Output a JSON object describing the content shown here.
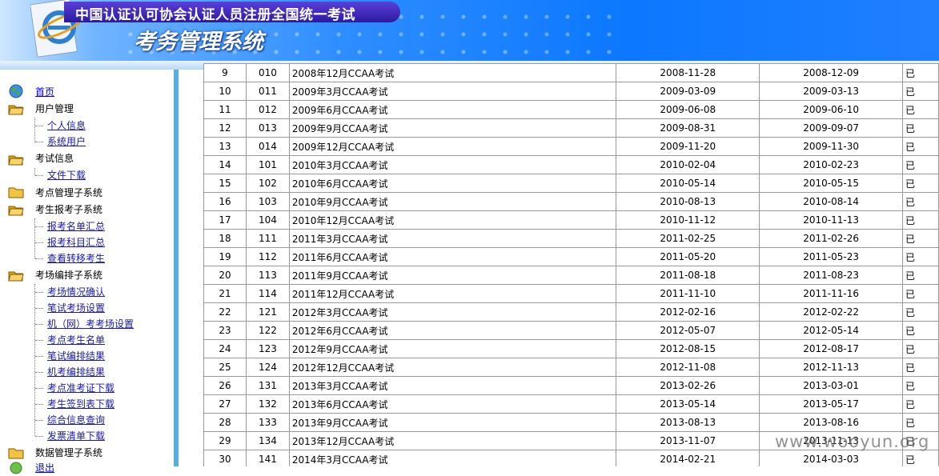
{
  "header": {
    "org_title": "中国认证认可协会认证人员注册全国统一考试",
    "system_title": "考务管理系统"
  },
  "menu": {
    "home": "首页",
    "user_mgmt": "用户管理",
    "personal_info": "个人信息",
    "system_user": "系统用户",
    "exam_info": "考试信息",
    "file_download": "文件下载",
    "site_subsystem": "考点管理子系统",
    "signup_subsystem": "考生报考子系统",
    "signup_list": "报考名单汇总",
    "signup_subjects": "报考科目汇总",
    "view_transfer": "查看转移考生",
    "room_subsystem": "考场编排子系统",
    "room_confirm": "考场情况确认",
    "written_room_setup": "笔试考场设置",
    "machine_room_setup": "机（网）考考场设置",
    "site_candidates": "考点考生名单",
    "written_result": "笔试编排结果",
    "machine_result": "机考编排结果",
    "admission_download": "考点准考证下载",
    "signin_download": "考生签到表下载",
    "info_query": "综合信息查询",
    "invoice_download": "发票清单下载",
    "data_subsystem": "数据管理子系统",
    "exit": "退出"
  },
  "table": {
    "rows": [
      {
        "no": "9",
        "code": "010",
        "name": "2008年12月CCAA考试",
        "start": "2008-11-28",
        "end": "2008-12-09",
        "status": "已"
      },
      {
        "no": "10",
        "code": "011",
        "name": "2009年3月CCAA考试",
        "start": "2009-03-09",
        "end": "2009-03-13",
        "status": "已"
      },
      {
        "no": "11",
        "code": "012",
        "name": "2009年6月CCAA考试",
        "start": "2009-06-08",
        "end": "2009-06-10",
        "status": "已"
      },
      {
        "no": "12",
        "code": "013",
        "name": "2009年9月CCAA考试",
        "start": "2009-08-31",
        "end": "2009-09-07",
        "status": "已"
      },
      {
        "no": "13",
        "code": "014",
        "name": "2009年12月CCAA考试",
        "start": "2009-11-20",
        "end": "2009-11-30",
        "status": "已"
      },
      {
        "no": "14",
        "code": "101",
        "name": "2010年3月CCAA考试",
        "start": "2010-02-04",
        "end": "2010-02-23",
        "status": "已"
      },
      {
        "no": "15",
        "code": "102",
        "name": "2010年6月CCAA考试",
        "start": "2010-05-14",
        "end": "2010-05-15",
        "status": "已"
      },
      {
        "no": "16",
        "code": "103",
        "name": "2010年9月CCAA考试",
        "start": "2010-08-13",
        "end": "2010-08-14",
        "status": "已"
      },
      {
        "no": "17",
        "code": "104",
        "name": "2010年12月CCAA考试",
        "start": "2010-11-12",
        "end": "2010-11-13",
        "status": "已"
      },
      {
        "no": "18",
        "code": "111",
        "name": "2011年3月CCAA考试",
        "start": "2011-02-25",
        "end": "2011-02-26",
        "status": "已"
      },
      {
        "no": "19",
        "code": "112",
        "name": "2011年6月CCAA考试",
        "start": "2011-05-20",
        "end": "2011-05-23",
        "status": "已"
      },
      {
        "no": "20",
        "code": "113",
        "name": "2011年9月CCAA考试",
        "start": "2011-08-18",
        "end": "2011-08-23",
        "status": "已"
      },
      {
        "no": "21",
        "code": "114",
        "name": "2011年12月CCAA考试",
        "start": "2011-11-10",
        "end": "2011-11-16",
        "status": "已"
      },
      {
        "no": "22",
        "code": "121",
        "name": "2012年3月CCAA考试",
        "start": "2012-02-16",
        "end": "2012-02-22",
        "status": "已"
      },
      {
        "no": "23",
        "code": "122",
        "name": "2012年6月CCAA考试",
        "start": "2012-05-07",
        "end": "2012-05-14",
        "status": "已"
      },
      {
        "no": "24",
        "code": "123",
        "name": "2012年9月CCAA考试",
        "start": "2012-08-15",
        "end": "2012-08-17",
        "status": "已"
      },
      {
        "no": "25",
        "code": "124",
        "name": "2012年12月CCAA考试",
        "start": "2012-11-08",
        "end": "2012-11-13",
        "status": "已"
      },
      {
        "no": "26",
        "code": "131",
        "name": "2013年3月CCAA考试",
        "start": "2013-02-26",
        "end": "2013-03-01",
        "status": "已"
      },
      {
        "no": "27",
        "code": "132",
        "name": "2013年6月CCAA考试",
        "start": "2013-05-14",
        "end": "2013-05-17",
        "status": "已"
      },
      {
        "no": "28",
        "code": "133",
        "name": "2013年9月CCAA考试",
        "start": "2013-08-13",
        "end": "2013-08-16",
        "status": "已"
      },
      {
        "no": "29",
        "code": "134",
        "name": "2013年12月CCAA考试",
        "start": "2013-11-07",
        "end": "2013-11-13",
        "status": "已"
      },
      {
        "no": "30",
        "code": "141",
        "name": "2014年3月CCAA考试",
        "start": "2014-02-21",
        "end": "2014-03-03",
        "status": "已"
      }
    ]
  },
  "watermark": "www.wooyun.org",
  "colors": {
    "sidebar_divider": "#55aeea",
    "link": "#0000ee",
    "header_blue": "#0c78ff"
  }
}
